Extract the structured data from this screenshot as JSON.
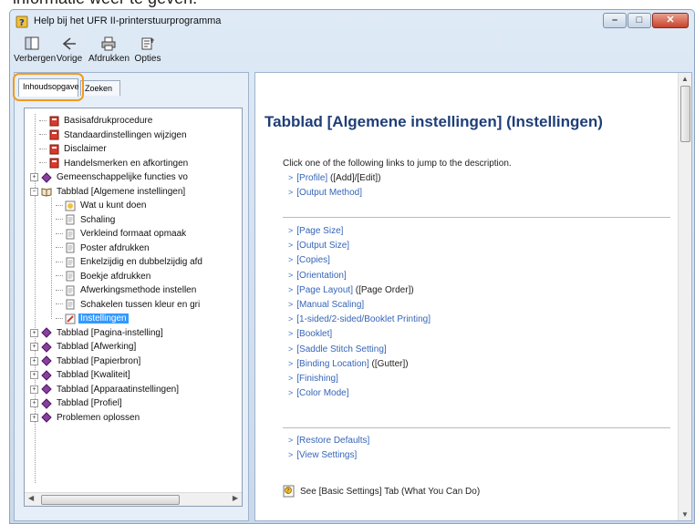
{
  "partial_top_text": "informatie weer te geven.",
  "window": {
    "title": "Help bij het UFR II-printerstuurprogramma",
    "buttons": {
      "minimize": "–",
      "maximize": "□",
      "close": "✕"
    }
  },
  "toolbar": {
    "hide": "Verbergen",
    "back": "Vorige",
    "print": "Afdrukken",
    "options": "Opties"
  },
  "tabs": {
    "contents": "Inhoudsopgave",
    "search": "Zoeken"
  },
  "tree": [
    {
      "label": "Basisafdrukprocedure",
      "level": 1,
      "icon": "red-book-icon"
    },
    {
      "label": "Standaardinstellingen wijzigen",
      "level": 1,
      "icon": "red-book-icon"
    },
    {
      "label": "Disclaimer",
      "level": 1,
      "icon": "red-book-icon"
    },
    {
      "label": "Handelsmerken en afkortingen",
      "level": 1,
      "icon": "red-book-icon"
    },
    {
      "label": "Gemeenschappelijke functies vo",
      "level": 1,
      "icon": "purple-book-icon",
      "expander": "+"
    },
    {
      "label": "Tabblad [Algemene instellingen]",
      "level": 1,
      "icon": "open-book-icon",
      "expander": "−"
    },
    {
      "label": "Wat u kunt doen",
      "level": 2,
      "icon": "tip-page-icon"
    },
    {
      "label": "Schaling",
      "level": 2,
      "icon": "page-icon"
    },
    {
      "label": "Verkleind formaat opmaak",
      "level": 2,
      "icon": "page-icon"
    },
    {
      "label": "Poster afdrukken",
      "level": 2,
      "icon": "page-icon"
    },
    {
      "label": "Enkelzijdig en dubbelzijdig afd",
      "level": 2,
      "icon": "page-icon"
    },
    {
      "label": "Boekje afdrukken",
      "level": 2,
      "icon": "page-icon"
    },
    {
      "label": "Afwerkingsmethode instellen",
      "level": 2,
      "icon": "page-icon"
    },
    {
      "label": "Schakelen tussen kleur en gri",
      "level": 2,
      "icon": "page-icon"
    },
    {
      "label": "Instellingen",
      "level": 2,
      "icon": "settings-page-icon",
      "selected": true
    },
    {
      "label": "Tabblad [Pagina-instelling]",
      "level": 1,
      "icon": "purple-book-icon",
      "expander": "+"
    },
    {
      "label": "Tabblad [Afwerking]",
      "level": 1,
      "icon": "purple-book-icon",
      "expander": "+"
    },
    {
      "label": "Tabblad [Papierbron]",
      "level": 1,
      "icon": "purple-book-icon",
      "expander": "+"
    },
    {
      "label": "Tabblad [Kwaliteit]",
      "level": 1,
      "icon": "purple-book-icon",
      "expander": "+"
    },
    {
      "label": "Tabblad [Apparaatinstellingen]",
      "level": 1,
      "icon": "purple-book-icon",
      "expander": "+"
    },
    {
      "label": "Tabblad [Profiel]",
      "level": 1,
      "icon": "purple-book-icon",
      "expander": "+"
    },
    {
      "label": "Problemen oplossen",
      "level": 1,
      "icon": "purple-book-icon",
      "expander": "+"
    }
  ],
  "content": {
    "title": "Tabblad [Algemene instellingen] (Instellingen)",
    "intro": "Click one of the following links to jump to the description.",
    "group1": [
      {
        "text": "[Profile]",
        "suffix": " ([Add]/[Edit])"
      },
      {
        "text": "[Output Method]",
        "suffix": ""
      }
    ],
    "group2": [
      {
        "text": "[Page Size]",
        "suffix": ""
      },
      {
        "text": "[Output Size]",
        "suffix": ""
      },
      {
        "text": "[Copies]",
        "suffix": ""
      },
      {
        "text": "[Orientation]",
        "suffix": ""
      },
      {
        "text": "[Page Layout]",
        "suffix": " ([Page Order])"
      },
      {
        "text": "[Manual Scaling]",
        "suffix": ""
      },
      {
        "text": "[1-sided/2-sided/Booklet Printing]",
        "suffix": ""
      },
      {
        "text": "[Booklet]",
        "suffix": ""
      },
      {
        "text": "[Saddle Stitch Setting]",
        "suffix": ""
      },
      {
        "text": "[Binding Location]",
        "suffix": " ([Gutter])"
      },
      {
        "text": "[Finishing]",
        "suffix": ""
      },
      {
        "text": "[Color Mode]",
        "suffix": ""
      }
    ],
    "group3": [
      {
        "text": "[Restore Defaults]",
        "suffix": ""
      },
      {
        "text": "[View Settings]",
        "suffix": ""
      }
    ],
    "see_also": "See [Basic Settings] Tab (What You Can Do)",
    "arrow_glyph": ">"
  },
  "colors": {
    "title": "#1f3e78",
    "link": "#3565b8",
    "highlight": "#f29a1d",
    "selection": "#3399ff"
  }
}
